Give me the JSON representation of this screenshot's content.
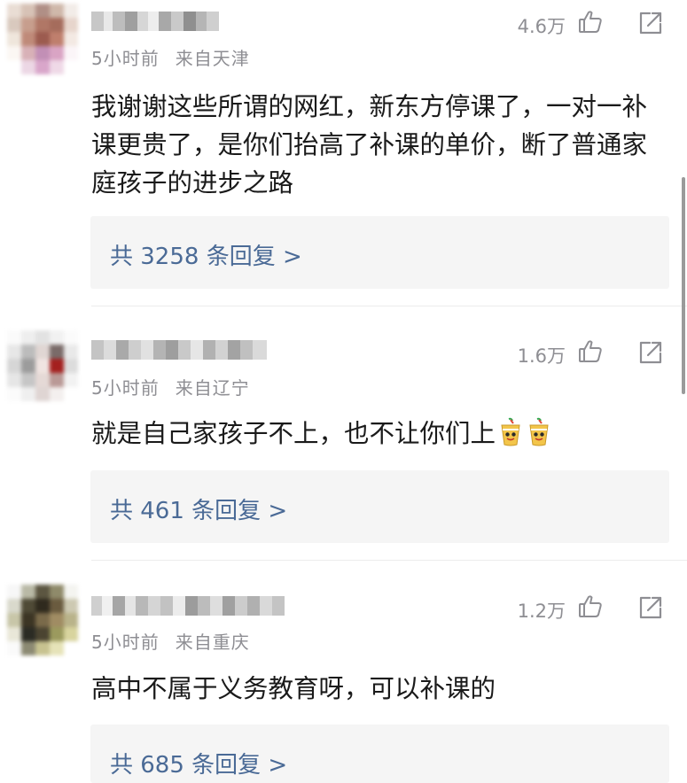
{
  "comments": [
    {
      "time": "5小时前",
      "location": "来自天津",
      "likes": "4.6万",
      "text": "我谢谢这些所谓的网红，新东方停课了，一对一补课更贵了，是你们抬高了补课的单价，断了普通家庭孩子的进步之路",
      "replies": "共 3258 条回复 >"
    },
    {
      "time": "5小时前",
      "location": "来自辽宁",
      "likes": "1.6万",
      "text": "就是自己家孩子不上，也不让你们上",
      "emoji_icon": "rooting-cup-emoji-icon",
      "replies": "共 461 条回复 >"
    },
    {
      "time": "5小时前",
      "location": "来自重庆",
      "likes": "1.2万",
      "text": "高中不属于义务教育呀，可以补课的",
      "replies": "共 685 条回复 >"
    }
  ],
  "colors": {
    "link": "#4a6a96",
    "meta": "#8e8e93",
    "reply_bg": "#f5f5f5"
  }
}
